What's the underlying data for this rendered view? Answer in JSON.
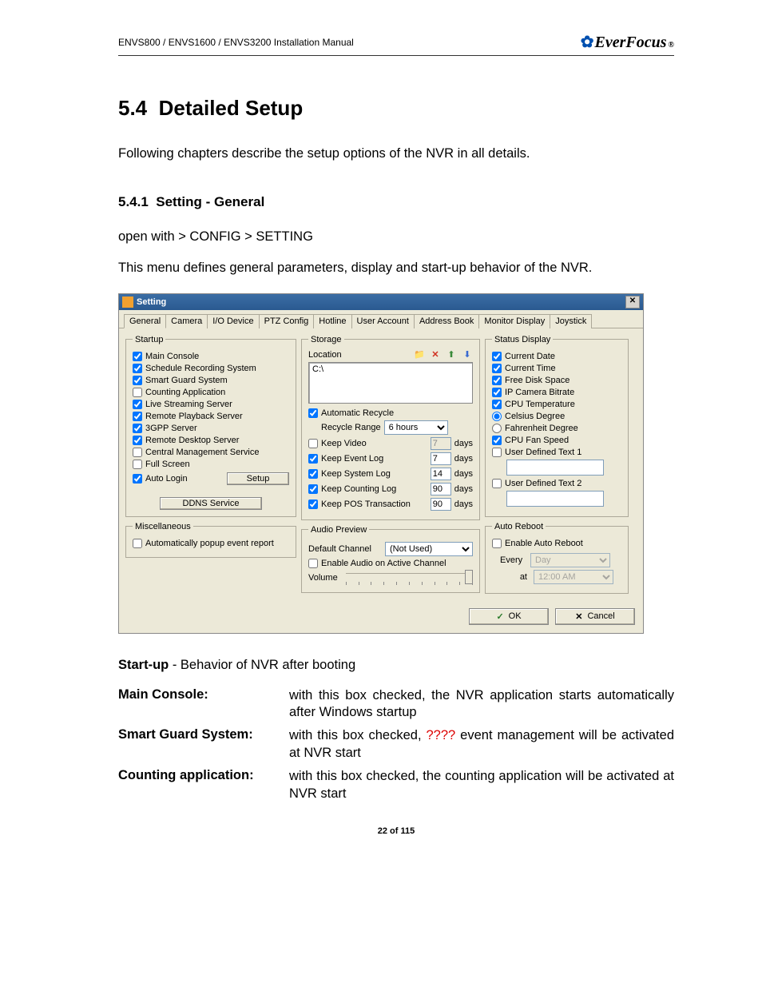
{
  "header": {
    "left": "ENVS800 / ENVS1600 / ENVS3200 Installation Manual",
    "brand": "EverFocus"
  },
  "section": {
    "number": "5.4",
    "title": "Detailed Setup",
    "intro": "Following chapters describe the setup options of the NVR in all details."
  },
  "subsection": {
    "number": "5.4.1",
    "title": "Setting - General",
    "nav": "open with > CONFIG > SETTING",
    "desc": "This menu defines general parameters, display and start-up behavior of the NVR."
  },
  "dialog": {
    "title": "Setting",
    "tabs": [
      "General",
      "Camera",
      "I/O Device",
      "PTZ Config",
      "Hotline",
      "User Account",
      "Address Book",
      "Monitor Display",
      "Joystick"
    ],
    "startup": {
      "legend": "Startup",
      "items": [
        {
          "label": "Main Console",
          "checked": true
        },
        {
          "label": "Schedule Recording System",
          "checked": true
        },
        {
          "label": "Smart Guard System",
          "checked": true
        },
        {
          "label": "Counting Application",
          "checked": false
        },
        {
          "label": "Live Streaming Server",
          "checked": true
        },
        {
          "label": "Remote Playback Server",
          "checked": true
        },
        {
          "label": "3GPP Server",
          "checked": true
        },
        {
          "label": "Remote Desktop Server",
          "checked": true
        },
        {
          "label": "Central Management Service",
          "checked": false
        },
        {
          "label": "Full Screen",
          "checked": false
        },
        {
          "label": "Auto Login",
          "checked": true
        }
      ],
      "setup_btn": "Setup",
      "ddns_btn": "DDNS Service"
    },
    "misc": {
      "legend": "Miscellaneous",
      "items": [
        {
          "label": "Automatically popup event report",
          "checked": false
        }
      ]
    },
    "storage": {
      "legend": "Storage",
      "location_label": "Location",
      "location_value": "C:\\",
      "auto_recycle": {
        "label": "Automatic Recycle",
        "checked": true
      },
      "recycle_range_label": "Recycle Range",
      "recycle_range_value": "6 hours",
      "keep": [
        {
          "label": "Keep Video",
          "checked": false,
          "value": "7",
          "enabled": false,
          "unit": "days"
        },
        {
          "label": "Keep Event Log",
          "checked": true,
          "value": "7",
          "enabled": true,
          "unit": "days"
        },
        {
          "label": "Keep System Log",
          "checked": true,
          "value": "14",
          "enabled": true,
          "unit": "days"
        },
        {
          "label": "Keep Counting Log",
          "checked": true,
          "value": "90",
          "enabled": true,
          "unit": "days"
        },
        {
          "label": "Keep POS Transaction",
          "checked": true,
          "value": "90",
          "enabled": true,
          "unit": "days"
        }
      ]
    },
    "audio": {
      "legend": "Audio Preview",
      "default_channel_label": "Default Channel",
      "default_channel_value": "(Not Used)",
      "enable_audio": {
        "label": "Enable Audio on Active Channel",
        "checked": false
      },
      "volume_label": "Volume"
    },
    "status": {
      "legend": "Status Display",
      "items": [
        {
          "label": "Current Date",
          "checked": true
        },
        {
          "label": "Current Time",
          "checked": true
        },
        {
          "label": "Free Disk Space",
          "checked": true
        },
        {
          "label": "IP Camera Bitrate",
          "checked": true
        },
        {
          "label": "CPU Temperature",
          "checked": true
        }
      ],
      "temp_unit": [
        {
          "label": "Celsius Degree",
          "selected": true
        },
        {
          "label": "Fahrenheit Degree",
          "selected": false
        }
      ],
      "cpu_fan": {
        "label": "CPU Fan Speed",
        "checked": true
      },
      "udt1": {
        "label": "User Defined Text 1",
        "checked": false
      },
      "udt2": {
        "label": "User Defined Text 2",
        "checked": false
      }
    },
    "reboot": {
      "legend": "Auto Reboot",
      "enable": {
        "label": "Enable Auto Reboot",
        "checked": false
      },
      "every_label": "Every",
      "every_value": "Day",
      "at_label": "at",
      "at_value": "12:00 AM"
    },
    "ok": "OK",
    "cancel": "Cancel"
  },
  "descriptions": {
    "startup_heading": "Start-up",
    "startup_heading_rest": " - Behavior of NVR after booting",
    "rows": [
      {
        "label": "Main Console:",
        "text_pre": "with this box checked,  the NVR application starts automatically after Windows startup",
        "red": ""
      },
      {
        "label": "Smart Guard System:",
        "text_pre": "with this box checked, ",
        "red": "????",
        "text_post": " event management will be activated at NVR start"
      },
      {
        "label": "Counting application:",
        "text_pre": "with this box checked, the counting application will be activated at NVR start",
        "red": ""
      }
    ]
  },
  "page_num": "22 of 115"
}
